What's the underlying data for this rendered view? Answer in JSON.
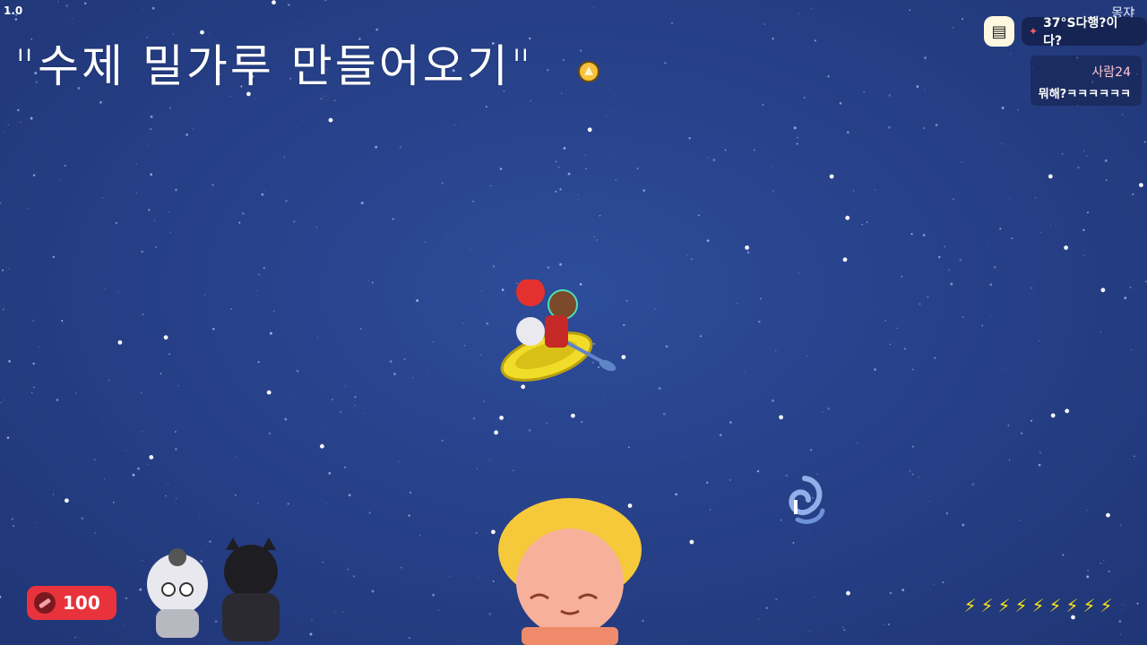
{
  "hud": {
    "version": "1.0",
    "top_username": "몽쟈",
    "temperature_status": "37°S다행?이다?",
    "chat_icon": "chat-bubble-icon",
    "pin_icon": "pin-icon"
  },
  "title_quote": "\"수제 밀가루 만들어오기\"",
  "chat": {
    "author": "사람24",
    "message": "뭐해?ㅋㅋㅋㅋㅋㅋ"
  },
  "inventory": {
    "coin_icon": "oar-icon",
    "count": "100"
  },
  "energy": {
    "filled": 9,
    "total": 10,
    "color_on": "#f7e316",
    "color_off": "#2d3f7c"
  },
  "colors": {
    "sea": "#263f86",
    "badge": "#e8333d",
    "boat": "#f2dc2a"
  }
}
